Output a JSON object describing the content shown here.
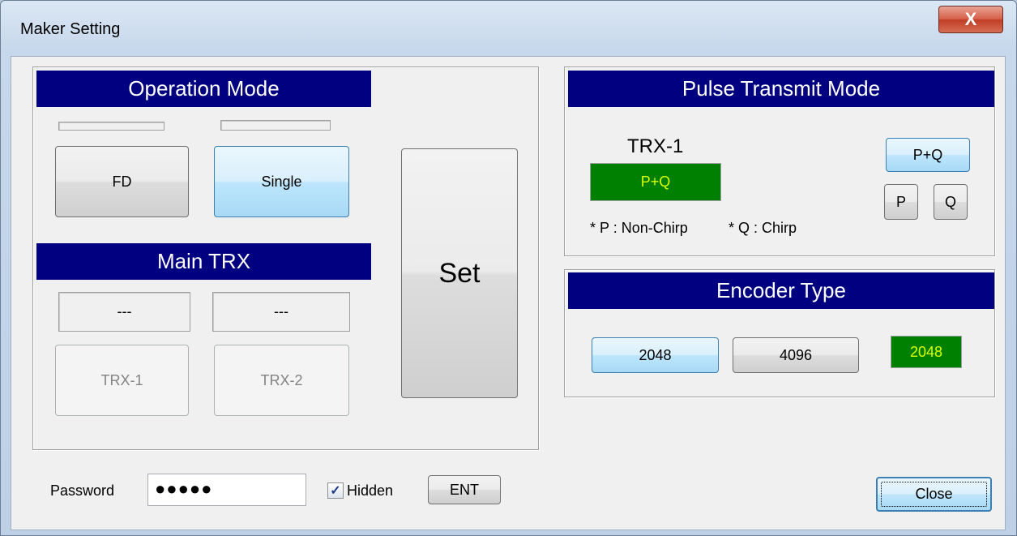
{
  "window": {
    "title": "Maker Setting",
    "close_glyph": "X"
  },
  "operation_mode": {
    "header": "Operation Mode",
    "fd_label": "FD",
    "single_label": "Single",
    "selected": "Single"
  },
  "main_trx": {
    "header": "Main TRX",
    "trx1_status": "---",
    "trx2_status": "---",
    "trx1_label": "TRX-1",
    "trx2_label": "TRX-2"
  },
  "set_button": "Set",
  "pulse_transmit": {
    "header": "Pulse Transmit Mode",
    "trx_label": "TRX-1",
    "current_value": "P+Q",
    "pq_label": "P+Q",
    "p_label": "P",
    "q_label": "Q",
    "note_p": "* P : Non-Chirp",
    "note_q": "* Q : Chirp"
  },
  "encoder": {
    "header": "Encoder Type",
    "opt_2048": "2048",
    "opt_4096": "4096",
    "current_value": "2048"
  },
  "footer": {
    "password_label": "Password",
    "password_value": "●●●●●",
    "hidden_label": "Hidden",
    "hidden_checked": true,
    "check_glyph": "✓",
    "ent_label": "ENT",
    "close_label": "Close"
  },
  "colors": {
    "header_bg": "#000080",
    "status_green": "#008000",
    "status_text": "#d8ff00",
    "selected_blue": "#bee6fd"
  }
}
